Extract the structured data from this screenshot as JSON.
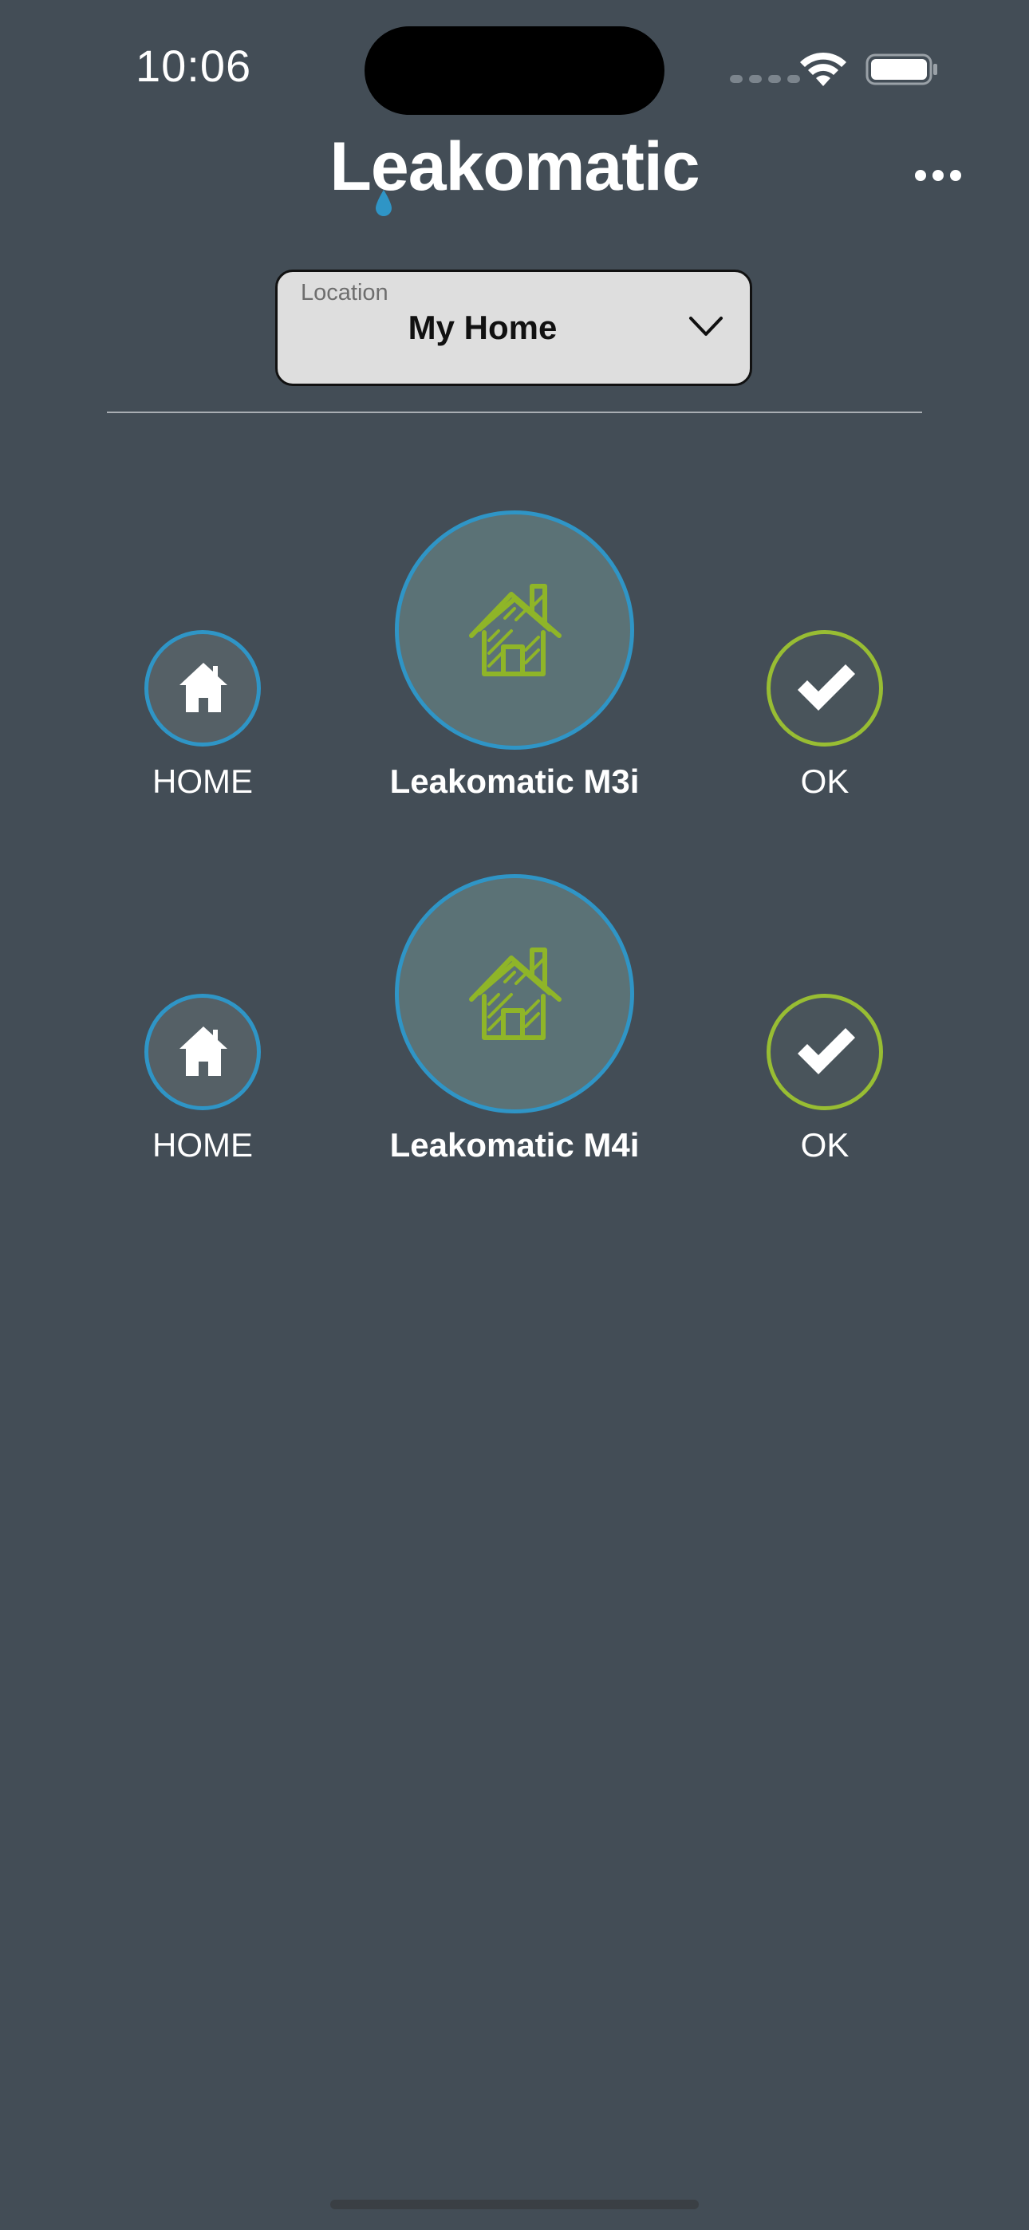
{
  "status_bar": {
    "time": "10:06"
  },
  "header": {
    "logo_text": "Leakomatic",
    "menu_icon": "ellipsis-icon"
  },
  "location": {
    "label": "Location",
    "value": "My Home"
  },
  "devices": [
    {
      "mode_label": "HOME",
      "mode_icon": "home-icon",
      "name": "Leakomatic M3i",
      "device_icon": "house-sketch-icon",
      "status_label": "OK",
      "status_icon": "checkmark-icon"
    },
    {
      "mode_label": "HOME",
      "mode_icon": "home-icon",
      "name": "Leakomatic M4i",
      "device_icon": "house-sketch-icon",
      "status_label": "OK",
      "status_icon": "checkmark-icon"
    }
  ],
  "colors": {
    "background": "#434d56",
    "accent_blue": "#2f95c6",
    "accent_green": "#98bd33",
    "select_background": "#dedede"
  }
}
